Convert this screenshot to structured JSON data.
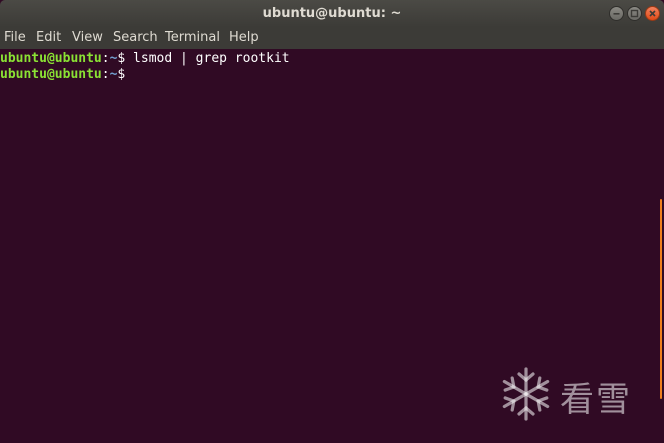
{
  "window": {
    "title": "ubuntu@ubuntu: ~"
  },
  "menu": {
    "file": "File",
    "edit": "Edit",
    "view": "View",
    "search": "Search",
    "terminal": "Terminal",
    "help": "Help"
  },
  "terminal": {
    "lines": [
      {
        "user": "ubuntu@ubuntu",
        "sep": ":",
        "path": "~",
        "symbol": "$",
        "command": " lsmod | grep rootkit"
      },
      {
        "user": "ubuntu@ubuntu",
        "sep": ":",
        "path": "~",
        "symbol": "$",
        "command": ""
      }
    ]
  },
  "watermark": {
    "text": "看雪",
    "icon": "snowflake-icon"
  },
  "colors": {
    "background": "#300a24",
    "prompt_user": "#8ae234",
    "prompt_path": "#729fcf",
    "titlebar": "#3c3b37",
    "close_button": "#df4a16"
  }
}
